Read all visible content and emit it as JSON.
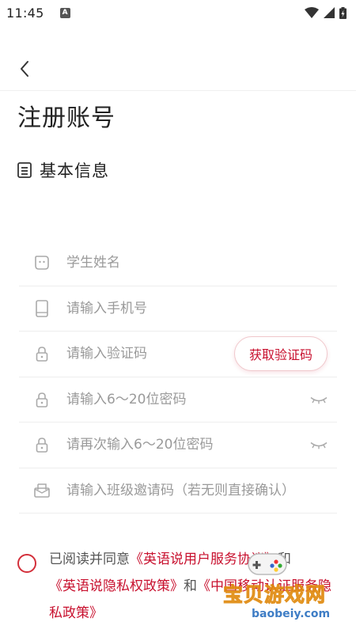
{
  "status_bar": {
    "time": "11:45",
    "notification_letter": "A"
  },
  "header": {
    "back_icon": "chevron-left-icon"
  },
  "page": {
    "title": "注册账号",
    "section_title": "基本信息"
  },
  "form": {
    "student_name_placeholder": "学生姓名",
    "phone_placeholder": "请输入手机号",
    "code_placeholder": "请输入验证码",
    "get_code_label": "获取验证码",
    "password_placeholder": "请输入6～20位密码",
    "confirm_password_placeholder": "请再次输入6～20位密码",
    "class_code_placeholder": "请输入班级邀请码（若无则直接确认）"
  },
  "agreement": {
    "prefix": "已阅读并同意",
    "user_agreement_link": "《英语说用户服务协议》",
    "and1": "和",
    "privacy_link": "《英语说隐私权政策》",
    "and2": "和",
    "third_link": "《中国移动认证服务隐私政策》"
  },
  "watermark": {
    "name": "宝贝游戏网",
    "url": "baobeiy.com"
  },
  "colors": {
    "accent": "#c8102e",
    "placeholder": "#9a9a9a",
    "divider": "#eeeeee"
  }
}
